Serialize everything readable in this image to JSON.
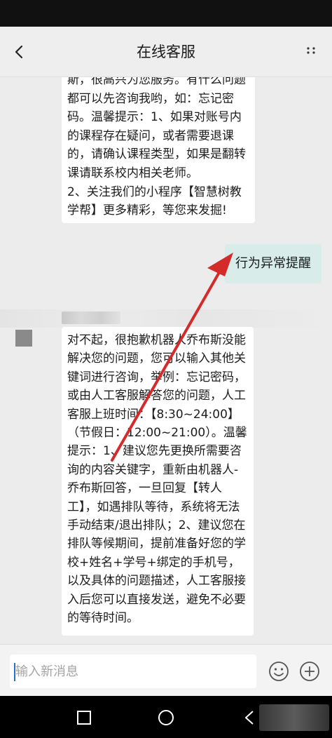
{
  "header": {
    "title": "在线客服",
    "back_icon": "chevron-left-icon",
    "more_icon": "more-vertical-icon"
  },
  "messages": {
    "bot_message_1": "斯，很高兴为您服务。有什么问题都可以先咨询我哟，如：忘记密码。温馨提示：1、如果对账号内的课程存在疑问，或者需要退课的，请确认课程类型，如果是翻转课请联系校内相关老师。\n2、关注我们的小程序【智慧树教学帮】更多精彩，等您来发掘!",
    "user_message": "行为异常提醒",
    "bot_message_2": "对不起，很抱歉机器人乔布斯没能解决您的问题，您可以输入其他关键词进行咨询，举例：忘记密码，或由人工客服解答您的问题，人工客服上班时间：【8:30~24:00】（节假日：12:00~21:00）。温馨提示：1、建议您先更换所需要咨询的内容关键字，重新由机器人-乔布斯回答，一旦回复【转人工】，如遇排队等待，系统将无法手动结束/退出排队；2、建议您在排队等候期间，提前准备好您的学校+姓名+学号+绑定的手机号，以及具体的问题描述，人工客服接入后您可以直接发送，避免不必要的等待时间。"
  },
  "input": {
    "placeholder": "输入新消息",
    "value": ""
  },
  "icons": {
    "emoji": "smiley-icon",
    "add": "plus-circle-icon",
    "nav_recent": "square-icon",
    "nav_home": "circle-icon",
    "nav_back": "triangle-left-icon"
  },
  "colors": {
    "outgoing_bubble": "#d8ecea",
    "incoming_bubble": "#ffffff",
    "annotation_arrow": "#d42a2a",
    "background": "#ececec"
  }
}
